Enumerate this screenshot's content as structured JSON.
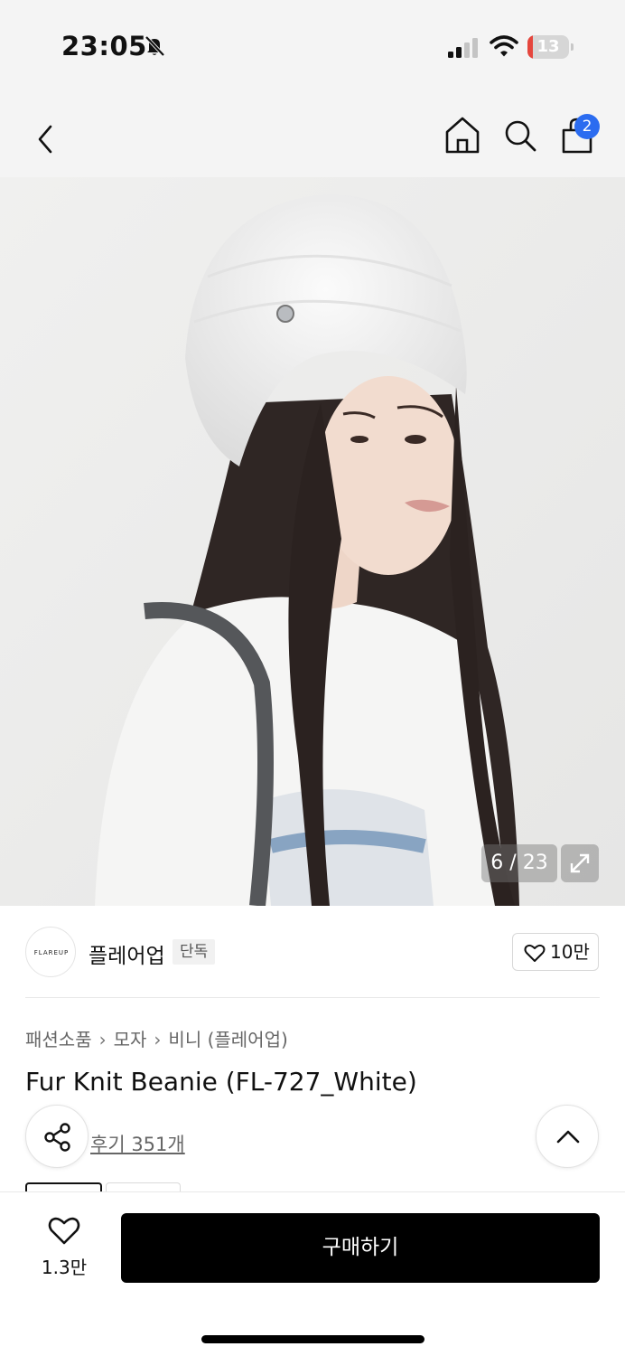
{
  "status_bar": {
    "time": "23:05",
    "battery_level": "13",
    "battery_percent": 13,
    "battery_color": "#e5463d",
    "signal_bars_active": 2,
    "signal_bars_total": 4,
    "icons": [
      "bell-slash-icon",
      "signal-icon",
      "wifi-icon",
      "battery-icon"
    ]
  },
  "nav": {
    "icons": [
      "chevron-left-icon",
      "home-icon",
      "search-icon",
      "shopping-bag-icon"
    ],
    "cart_count": "2",
    "badge_color": "#2b6cf0"
  },
  "gallery": {
    "counter": "6 / 23",
    "icon": "expand-icon"
  },
  "brand": {
    "logo_text": "FLAREUP",
    "name": "플레어업",
    "tag": "단독",
    "likes": "10만"
  },
  "breadcrumb": [
    "패션소품",
    "모자",
    "비니 (플레어업)"
  ],
  "product": {
    "title": "Fur Knit Beanie (FL-727_White)",
    "reviews": "후기 351개"
  },
  "actions": {
    "wish_count": "1.3만",
    "buy_label": "구매하기"
  }
}
